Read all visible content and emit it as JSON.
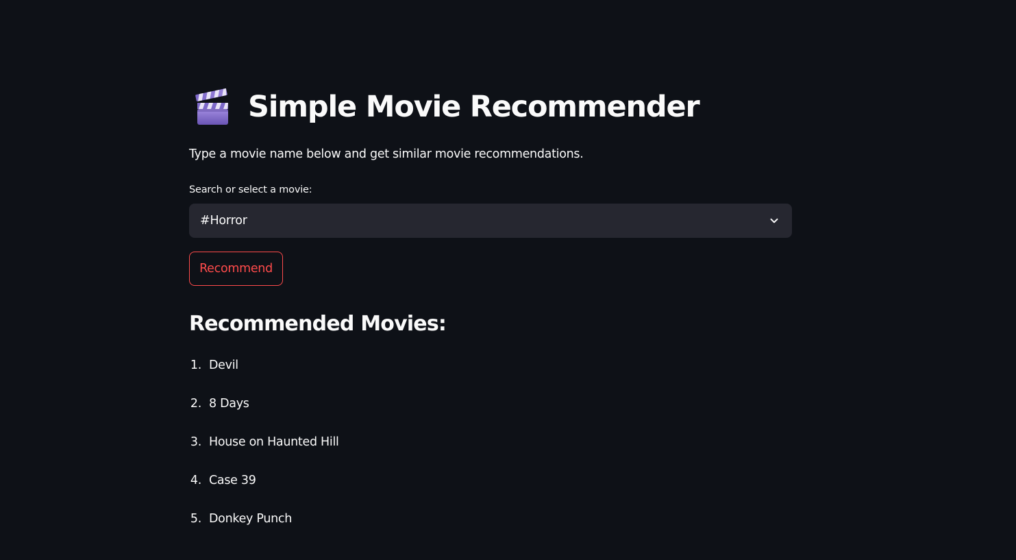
{
  "header": {
    "icon": "clapper-board-icon",
    "title": "Simple Movie Recommender"
  },
  "intro": {
    "text": "Type a movie name below and get similar movie recommendations."
  },
  "movie_select": {
    "label": "Search or select a movie:",
    "selected_value": "#Horror"
  },
  "recommend_button": {
    "label": "Recommend"
  },
  "results": {
    "heading": "Recommended Movies:",
    "items": [
      {
        "number": "1.",
        "title": "Devil"
      },
      {
        "number": "2.",
        "title": "8 Days"
      },
      {
        "number": "3.",
        "title": "House on Haunted Hill"
      },
      {
        "number": "4.",
        "title": "Case 39"
      },
      {
        "number": "5.",
        "title": "Donkey Punch"
      }
    ]
  },
  "colors": {
    "background": "#0e1117",
    "text": "#fafafa",
    "select_background": "#262730",
    "accent": "#ff4b4b"
  }
}
